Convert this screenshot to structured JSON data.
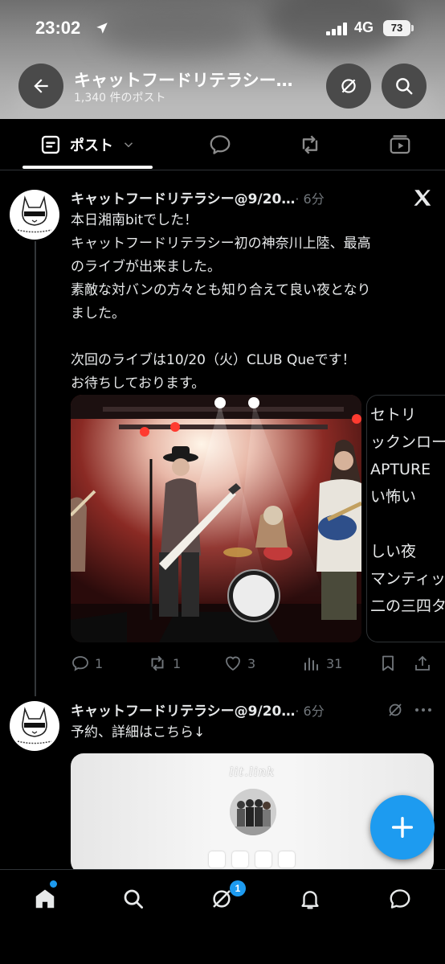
{
  "status_bar": {
    "time": "23:02",
    "network": "4G",
    "battery": "73"
  },
  "header": {
    "title": "キャットフードリテラシー…",
    "post_count": "1,340 件のポスト"
  },
  "tabs": {
    "posts_label": "ポスト",
    "icons": [
      "posts-icon",
      "replies-icon",
      "reposts-icon",
      "media-icon"
    ]
  },
  "tweets": [
    {
      "author": "キャットフードリテラシー@9/20…",
      "time": "· 6分",
      "lines": [
        "本日湘南bitでした！",
        "キャットフードリテラシー初の神奈川上陸、最高",
        "のライブが出来ました。",
        "素敵な対バンの方々とも知り合えて良い夜となり",
        "ました。",
        "",
        "次回のライブは10/20（火）CLUB Queです！",
        "お待ちしております。"
      ],
      "setlist_preview": [
        "セトリ",
        "ックンロー",
        "APTURE",
        "い怖い",
        "",
        "しい夜",
        "マンティッ",
        "二の三四タ"
      ],
      "replies": "1",
      "reposts": "1",
      "likes": "3",
      "views": "31"
    },
    {
      "author": "キャットフードリテラシー@9/20…",
      "time": "· 6分",
      "lines": [
        "予約、詳細はこちら↓"
      ],
      "card_brand": "lit.link"
    }
  ],
  "bottom_nav": {
    "items": [
      "home-icon",
      "search-icon",
      "grok-icon",
      "notifications-icon",
      "messages-icon"
    ],
    "grok_badge": "1"
  },
  "colors": {
    "accent": "#1d9bf0",
    "background": "#000000",
    "muted_text": "#71767b",
    "primary_text": "#e7e9ea"
  }
}
